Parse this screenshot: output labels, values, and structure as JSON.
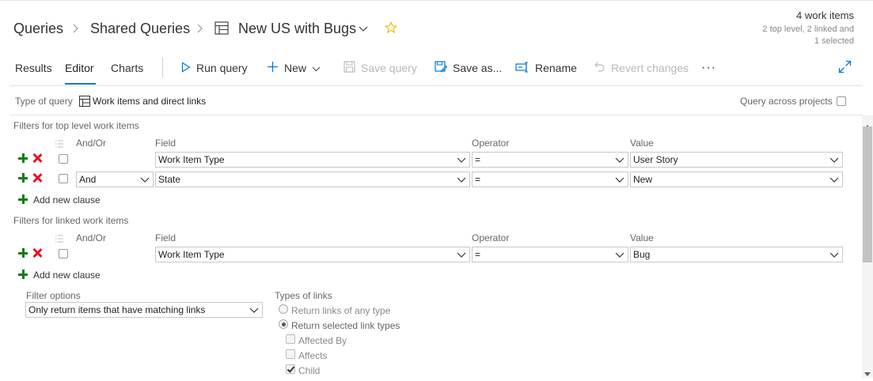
{
  "breadcrumb": {
    "root": "Queries",
    "folder": "Shared Queries",
    "current": "New US with Bugs"
  },
  "summary": {
    "count": "4 work items",
    "detail_line1": "2 top level, 2 linked and",
    "detail_line2": "1 selected"
  },
  "tabs": [
    {
      "label": "Results"
    },
    {
      "label": "Editor"
    },
    {
      "label": "Charts"
    }
  ],
  "toolbar": {
    "run_query": "Run query",
    "new": "New",
    "save_query": "Save query",
    "save_as": "Save as...",
    "rename": "Rename",
    "revert": "Revert changes",
    "more": "···"
  },
  "query_type": {
    "label": "Type of query",
    "value": "Work items and direct links",
    "across_projects": "Query across projects"
  },
  "top_filters": {
    "section_label": "Filters for top level work items",
    "headers": {
      "andor": "And/Or",
      "field": "Field",
      "operator": "Operator",
      "value": "Value"
    },
    "rows": [
      {
        "andor": "",
        "field": "Work Item Type",
        "operator": "=",
        "value": "User Story"
      },
      {
        "andor": "And",
        "field": "State",
        "operator": "=",
        "value": "New"
      }
    ],
    "add_clause": "Add new clause"
  },
  "linked_filters": {
    "section_label": "Filters for linked work items",
    "headers": {
      "andor": "And/Or",
      "field": "Field",
      "operator": "Operator",
      "value": "Value"
    },
    "rows": [
      {
        "andor": "",
        "field": "Work Item Type",
        "operator": "=",
        "value": "Bug"
      }
    ],
    "add_clause": "Add new clause"
  },
  "filter_options": {
    "label": "Filter options",
    "value": "Only return items that have matching links"
  },
  "link_types": {
    "label": "Types of links",
    "any": "Return links of any type",
    "selected": "Return selected link types",
    "items": [
      {
        "label": "Affected By",
        "checked": false
      },
      {
        "label": "Affects",
        "checked": false
      },
      {
        "label": "Child",
        "checked": true
      }
    ]
  },
  "colors": {
    "accent": "#0078d4",
    "add": "#107c10",
    "remove": "#e81123",
    "star": "#f2b600"
  }
}
